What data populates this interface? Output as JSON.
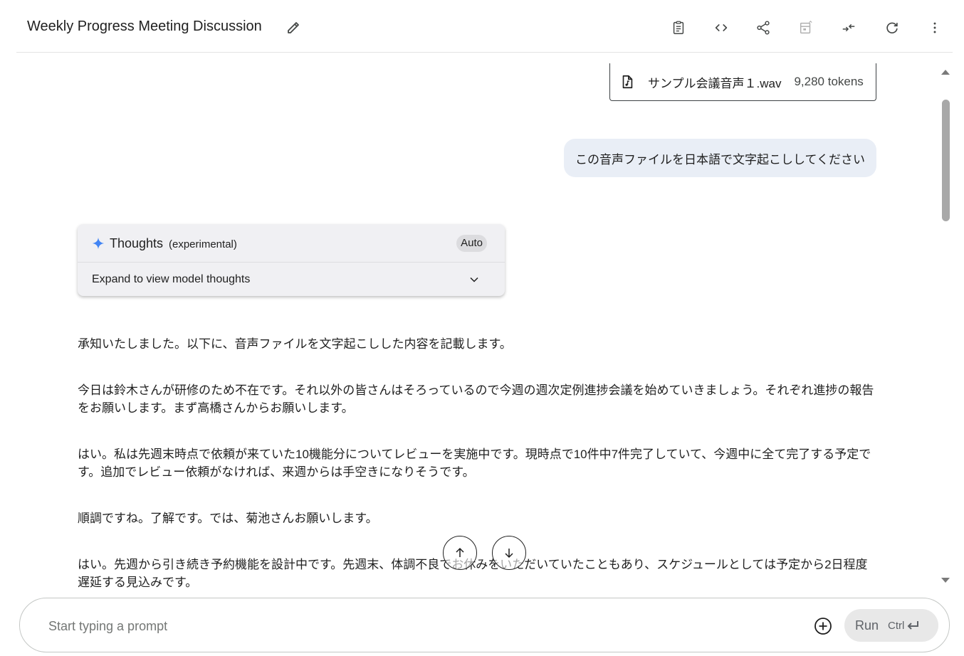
{
  "header": {
    "title": "Weekly Progress Meeting Discussion",
    "toolbar_icons": [
      "clipboard-icon",
      "code-icon",
      "share-icon",
      "compare-icon",
      "collapse-icon",
      "refresh-icon",
      "more-vert-icon"
    ]
  },
  "attachment": {
    "file_name": "サンプル会議音声１.wav",
    "tokens": "9,280 tokens"
  },
  "user_message": "この音声ファイルを日本語で文字起こししてください",
  "thoughts": {
    "title": "Thoughts",
    "subtitle": "(experimental)",
    "badge": "Auto",
    "expand_label": "Expand to view model thoughts"
  },
  "response": {
    "paragraphs": [
      "承知いたしました。以下に、音声ファイルを文字起こしした内容を記載します。",
      "今日は鈴木さんが研修のため不在です。それ以外の皆さんはそろっているので今週の週次定例進捗会議を始めていきましょう。それぞれ進捗の報告をお願いします。まず高橋さんからお願いします。",
      "はい。私は先週末時点で依頼が来ていた10機能分についてレビューを実施中です。現時点で10件中7件完了していて、今週中に全て完了する予定です。追加でレビュー依頼がなければ、来週からは手空きになりそうです。",
      "順調ですね。了解です。では、菊池さんお願いします。",
      "はい。先週から引き続き予約機能を設計中です。先週末、体調不良でお休みをいただいていたこともあり、スケジュールとしては予定から2日程度遅延する見込みです。"
    ]
  },
  "prompt": {
    "placeholder": "Start typing a prompt",
    "value": "",
    "run_label": "Run",
    "shortcut": "Ctrl"
  },
  "colors": {
    "user_bubble": "#e9eef6",
    "thoughts_bg": "#f0f0f3",
    "spark": "#4285f4"
  }
}
